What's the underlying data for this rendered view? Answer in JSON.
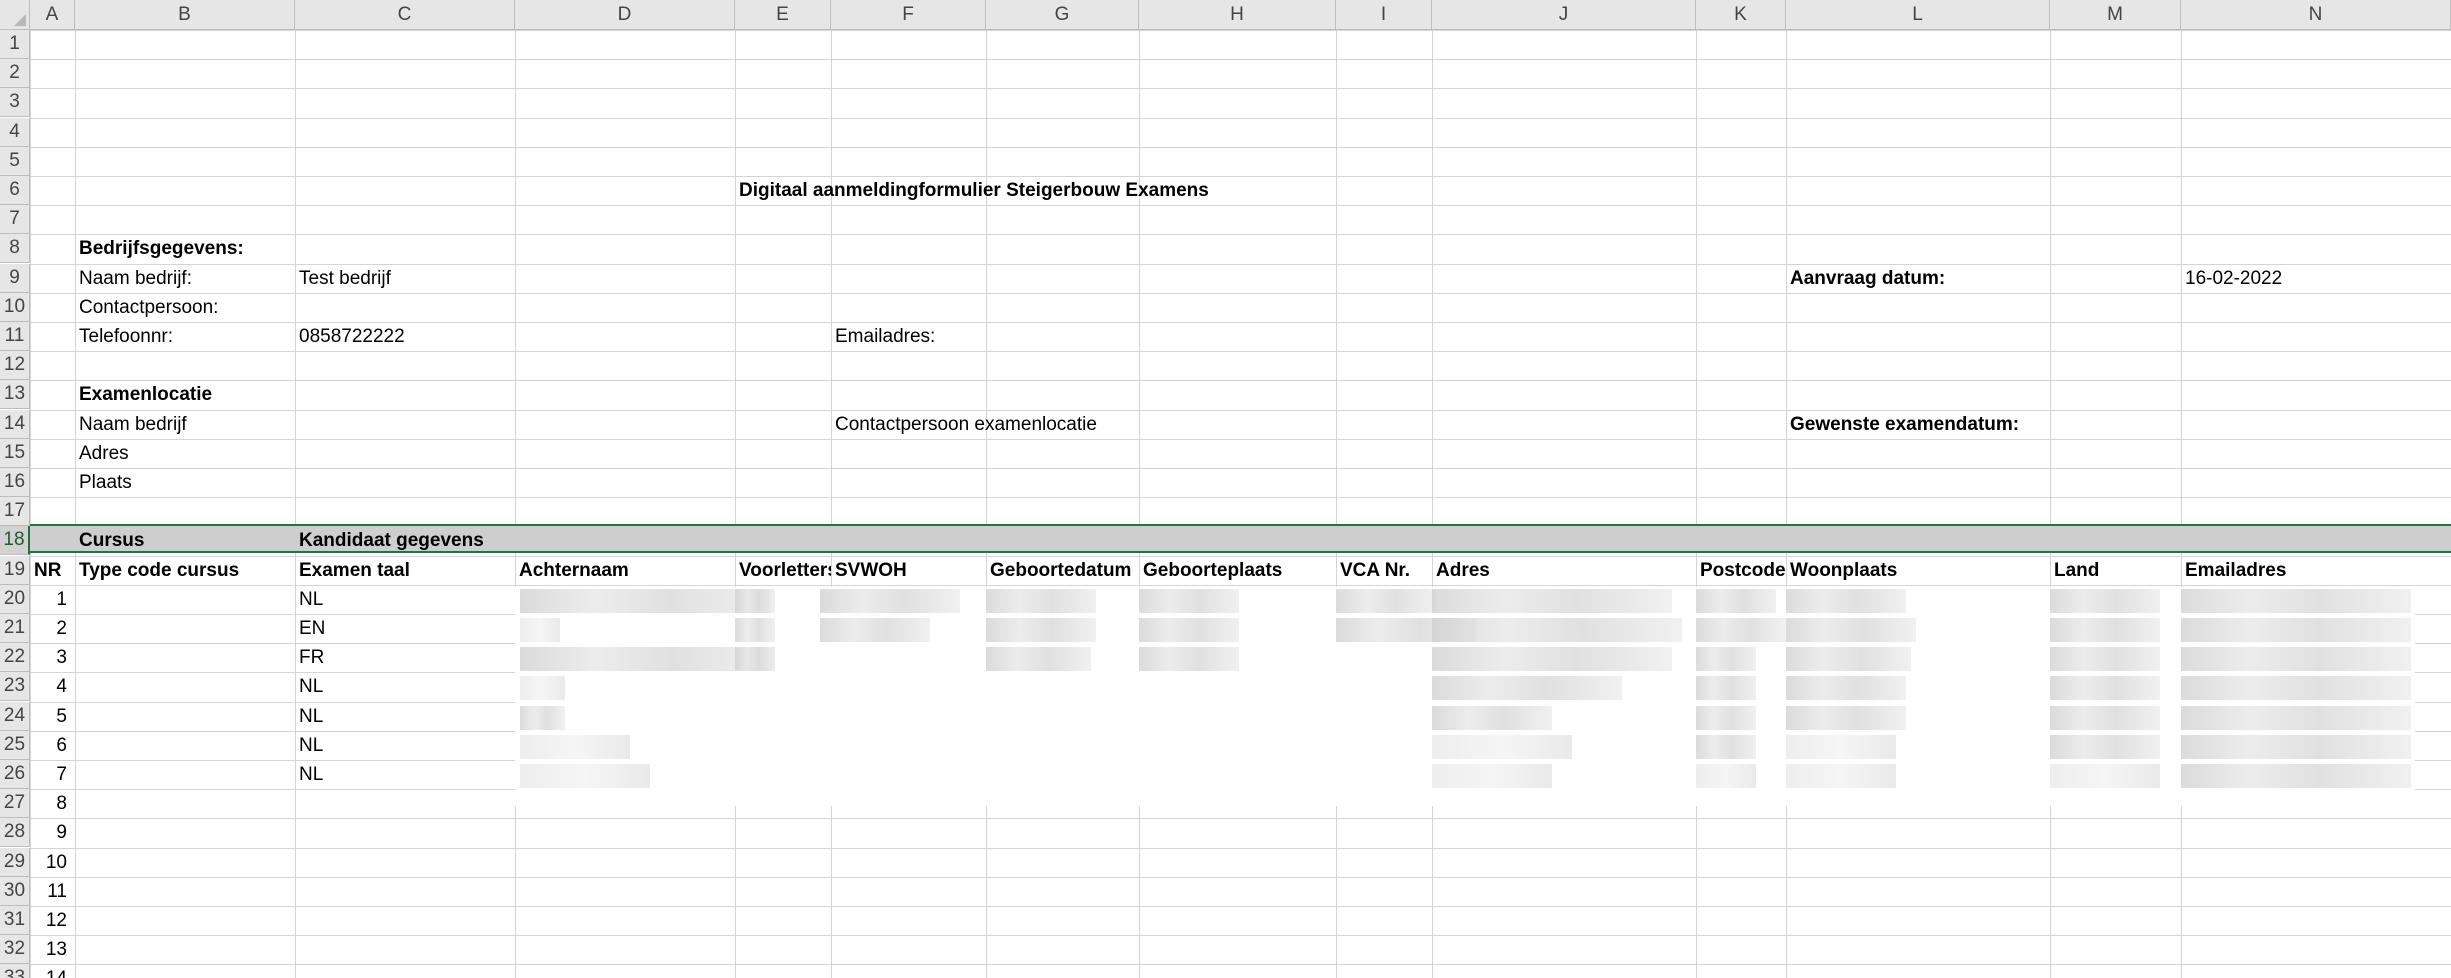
{
  "columns": [
    "A",
    "B",
    "C",
    "D",
    "E",
    "F",
    "G",
    "H",
    "I",
    "J",
    "K",
    "L",
    "M",
    "N"
  ],
  "rows": [
    "1",
    "2",
    "3",
    "4",
    "5",
    "6",
    "7",
    "8",
    "9",
    "10",
    "11",
    "12",
    "13",
    "14",
    "15",
    "16",
    "17",
    "18",
    "19",
    "20",
    "21",
    "22",
    "23",
    "24",
    "25",
    "26",
    "27",
    "28",
    "29",
    "30",
    "31",
    "32",
    "33"
  ],
  "selected_row": "18",
  "form": {
    "title": "Digitaal aanmeldingformulier Steigerbouw Examens",
    "company_section": "Bedrijfsgegevens:",
    "company_name_label": "Naam bedrijf:",
    "company_name_value": "Test bedrijf",
    "contact_label": "Contactpersoon:",
    "phone_label": "Telefoonnr:",
    "phone_value": "0858722222",
    "email_label": "Emailadres:",
    "request_date_label": "Aanvraag datum:",
    "request_date_value": "16-02-2022",
    "location_section": "Examenlocatie",
    "location_name_label": "Naam bedrijf",
    "location_contact_label": "Contactpersoon examenlocatie",
    "desired_date_label": "Gewenste examendatum:",
    "address_label": "Adres",
    "city_label": "Plaats"
  },
  "candidates_table": {
    "section_course": "Cursus",
    "section_candidate": "Kandidaat gegevens",
    "headers": [
      "NR",
      "Type code cursus",
      "Examen taal",
      "Achternaam",
      "Voorletters",
      "SVWOH",
      "Geboortedatum",
      "Geboorteplaats",
      "VCA Nr.",
      "Adres",
      "Postcode",
      "Woonplaats",
      "Land",
      "Emailadres"
    ],
    "numbers": [
      "1",
      "2",
      "3",
      "4",
      "5",
      "6",
      "7",
      "8",
      "9",
      "10",
      "11",
      "12",
      "13",
      "14"
    ],
    "languages": [
      "NL",
      "EN",
      "FR",
      "NL",
      "NL",
      "NL",
      "NL"
    ]
  }
}
